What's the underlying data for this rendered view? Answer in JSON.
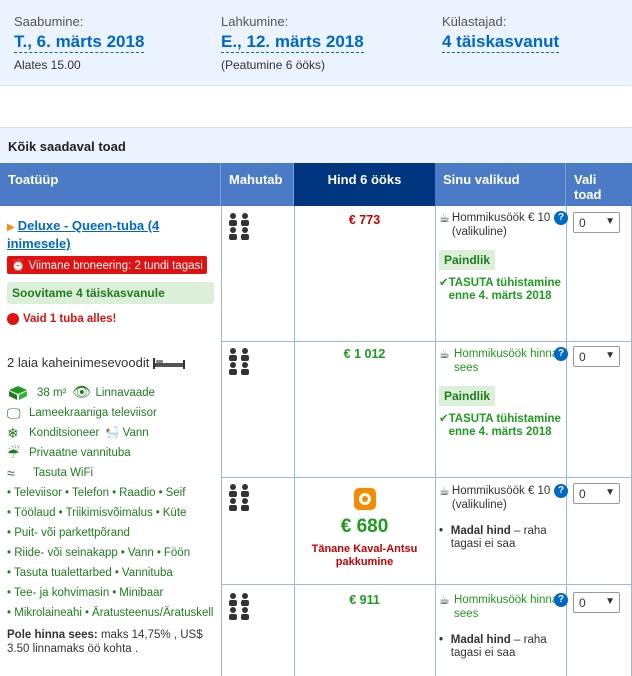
{
  "summary": {
    "checkin_label": "Saabumine:",
    "checkin_value": "T., 6. märts 2018",
    "checkin_note": "Alates 15.00",
    "checkout_label": "Lahkumine:",
    "checkout_value": "E., 12. märts 2018",
    "checkout_note": "(Peatumine 6 ööks)",
    "guests_label": "Külastajad:",
    "guests_value": "4 täiskasvanut"
  },
  "section_title": "Kõik saadaval toad",
  "columns": {
    "room_type": "Toatüüp",
    "capacity": "Mahutab",
    "price": "Hind 6 ööks",
    "choices": "Sinu valikud",
    "select": "Vali toad"
  },
  "room": {
    "name": "Deluxe - Queen-tuba (4 inimesele)",
    "last_booking": "Viimane broneering: 2 tundi tagasi",
    "recommend": "Soovitame 4 täiskasvanule",
    "only_left": "Vaid 1 tuba alles!",
    "beds": "2 laia kaheinimesevoodit",
    "size": "38 m²",
    "facilities": [
      {
        "icon": "city-view-icon",
        "label": "Linnavaade"
      },
      {
        "icon": "tv-icon",
        "label": "Lameekraaniga televiisor"
      },
      {
        "icon": "ac-icon",
        "label": "Konditsioneer"
      },
      {
        "icon": "bath-icon",
        "label": "Vann"
      },
      {
        "icon": "shower-icon",
        "label": "Privaatne vannituba"
      },
      {
        "icon": "wifi-icon",
        "label": "Tasuta WiFi"
      }
    ],
    "amenities": [
      "Televiisor",
      "Telefon",
      "Raadio",
      "Seif",
      "Töölaud",
      "Triikimisvõimalus",
      "Küte",
      "Puit- või parkettpõrand",
      "Riide- või seinakapp",
      "Vann",
      "Föön",
      "Tasuta tualettarbed",
      "Vannituba",
      "Tee- ja kohvimasin",
      "Minibaar",
      "Mikrolaineahi",
      "Äratusteenus/Äratuskell"
    ],
    "not_included_label": "Pole hinna sees:",
    "not_included_text": "maks 14,75% , US$ 3.50 linnamaks öö kohta ."
  },
  "offers": [
    {
      "price": "€ 773",
      "breakfast": "Hommikusöök € 10 (valikuline)",
      "flexible": "Paindlik",
      "cancel": "TASUTA tühistamine enne 4. märts 2018",
      "qty": "0"
    },
    {
      "price": "€ 1 012",
      "breakfast": "Hommikusöök hinna sees",
      "flexible": "Paindlik",
      "cancel": "TASUTA tühistamine enne 4. märts 2018",
      "qty": "0"
    },
    {
      "price": "€ 680",
      "deal": "Tänane Kaval-Antsu pakkumine",
      "breakfast": "Hommikusöök € 10 (valikuline)",
      "low_price": "Madal hind",
      "low_price_rest": "– raha tagasi ei saa",
      "qty": "0"
    },
    {
      "price": "€ 911",
      "breakfast": "Hommikusöök hinna sees",
      "low_price": "Madal hind",
      "low_price_rest": "– raha tagasi ei saa",
      "qty": "0"
    }
  ]
}
